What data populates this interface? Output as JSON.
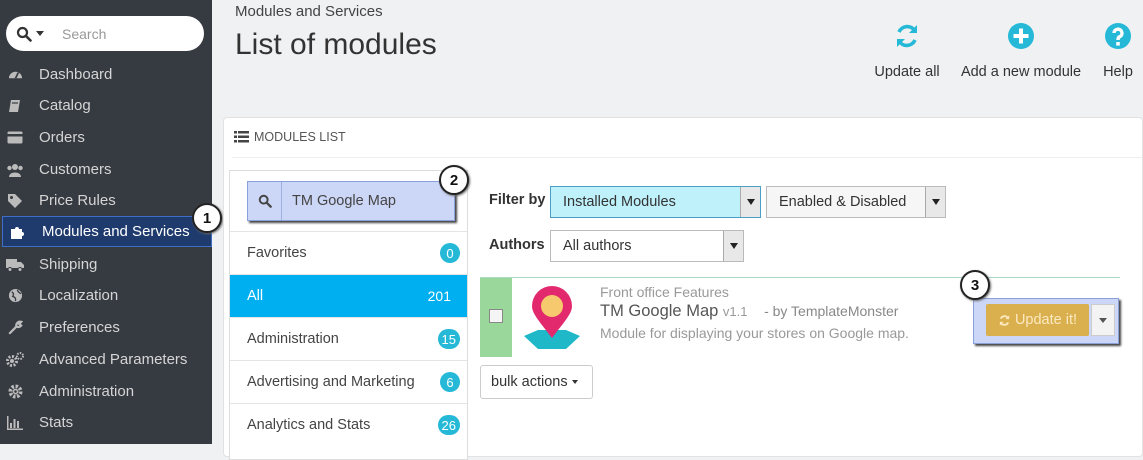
{
  "sidebar": {
    "search_placeholder": "Search",
    "items": [
      {
        "label": "Dashboard",
        "icon": "dashboard-icon"
      },
      {
        "label": "Catalog",
        "icon": "book-icon"
      },
      {
        "label": "Orders",
        "icon": "credit-card-icon"
      },
      {
        "label": "Customers",
        "icon": "users-icon"
      },
      {
        "label": "Price Rules",
        "icon": "tags-icon"
      },
      {
        "label": "Modules and Services",
        "icon": "puzzle-icon"
      },
      {
        "label": "Shipping",
        "icon": "truck-icon"
      },
      {
        "label": "Localization",
        "icon": "globe-icon"
      },
      {
        "label": "Preferences",
        "icon": "wrench-icon"
      },
      {
        "label": "Advanced Parameters",
        "icon": "cogs-icon"
      },
      {
        "label": "Administration",
        "icon": "gear-icon"
      },
      {
        "label": "Stats",
        "icon": "bar-chart-icon"
      }
    ]
  },
  "header": {
    "breadcrumb": "Modules and Services",
    "title": "List of modules",
    "toolbar": {
      "update_all": "Update all",
      "add_module": "Add a new module",
      "help": "Help"
    }
  },
  "panel": {
    "heading": "MODULES LIST",
    "search_value": "TM Google Map",
    "categories": [
      {
        "label": "Favorites",
        "count": "0"
      },
      {
        "label": "All",
        "count": "201"
      },
      {
        "label": "Administration",
        "count": "15"
      },
      {
        "label": "Advertising and Marketing",
        "count": "6"
      },
      {
        "label": "Analytics and Stats",
        "count": "26"
      }
    ],
    "filter": {
      "filter_label": "Filter by",
      "installed": "Installed Modules",
      "status": "Enabled & Disabled",
      "authors_label": "Authors",
      "authors_value": "All authors"
    },
    "module": {
      "category": "Front office Features",
      "name": "TM Google Map",
      "version": "v1.1",
      "author": "- by TemplateMonster",
      "description": "Module for displaying your stores on Google map.",
      "update_label": "Update it!"
    },
    "bulk_actions": "bulk actions"
  },
  "callouts": [
    "1",
    "2",
    "3"
  ],
  "colors": {
    "sidebar_bg": "#363a41",
    "active_category": "#00aff0",
    "badge": "#25b9d7",
    "update_button": "#dab04f",
    "toolbar_icon": "#25b9d7"
  }
}
